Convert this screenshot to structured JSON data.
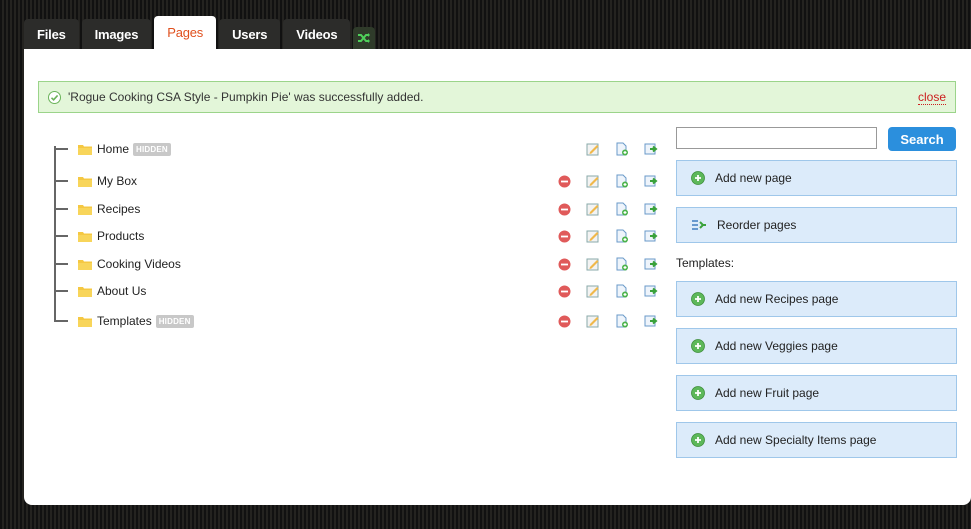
{
  "tabs": [
    {
      "label": "Files",
      "active": false
    },
    {
      "label": "Images",
      "active": false
    },
    {
      "label": "Pages",
      "active": true
    },
    {
      "label": "Users",
      "active": false
    },
    {
      "label": "Videos",
      "active": false
    }
  ],
  "shuffle_icon": "shuffle-icon",
  "notice": {
    "message": "'Rogue Cooking CSA Style - Pumpkin Pie' was successfully added.",
    "close_label": "close"
  },
  "tree": {
    "hidden_badge": "HIDDEN",
    "items": [
      {
        "label": "Home",
        "hidden": true,
        "deletable": false
      },
      {
        "label": "My Box",
        "hidden": false,
        "deletable": true
      },
      {
        "label": "Recipes",
        "hidden": false,
        "deletable": true
      },
      {
        "label": "Products",
        "hidden": false,
        "deletable": true
      },
      {
        "label": "Cooking Videos",
        "hidden": false,
        "deletable": true
      },
      {
        "label": "About Us",
        "hidden": false,
        "deletable": true
      },
      {
        "label": "Templates",
        "hidden": true,
        "deletable": true
      }
    ]
  },
  "search": {
    "value": "",
    "button_label": "Search"
  },
  "side_buttons": {
    "add_new_page": "Add new page",
    "reorder_pages": "Reorder pages"
  },
  "templates": {
    "label": "Templates:",
    "items": [
      "Add new Recipes page",
      "Add new Veggies page",
      "Add new Fruit page",
      "Add new Specialty Items page"
    ]
  },
  "colors": {
    "accent_tab": "#e0501e",
    "search_button": "#2b8fdd",
    "notice_bg": "#e3f6d9",
    "side_button_bg": "#dcebfa"
  }
}
